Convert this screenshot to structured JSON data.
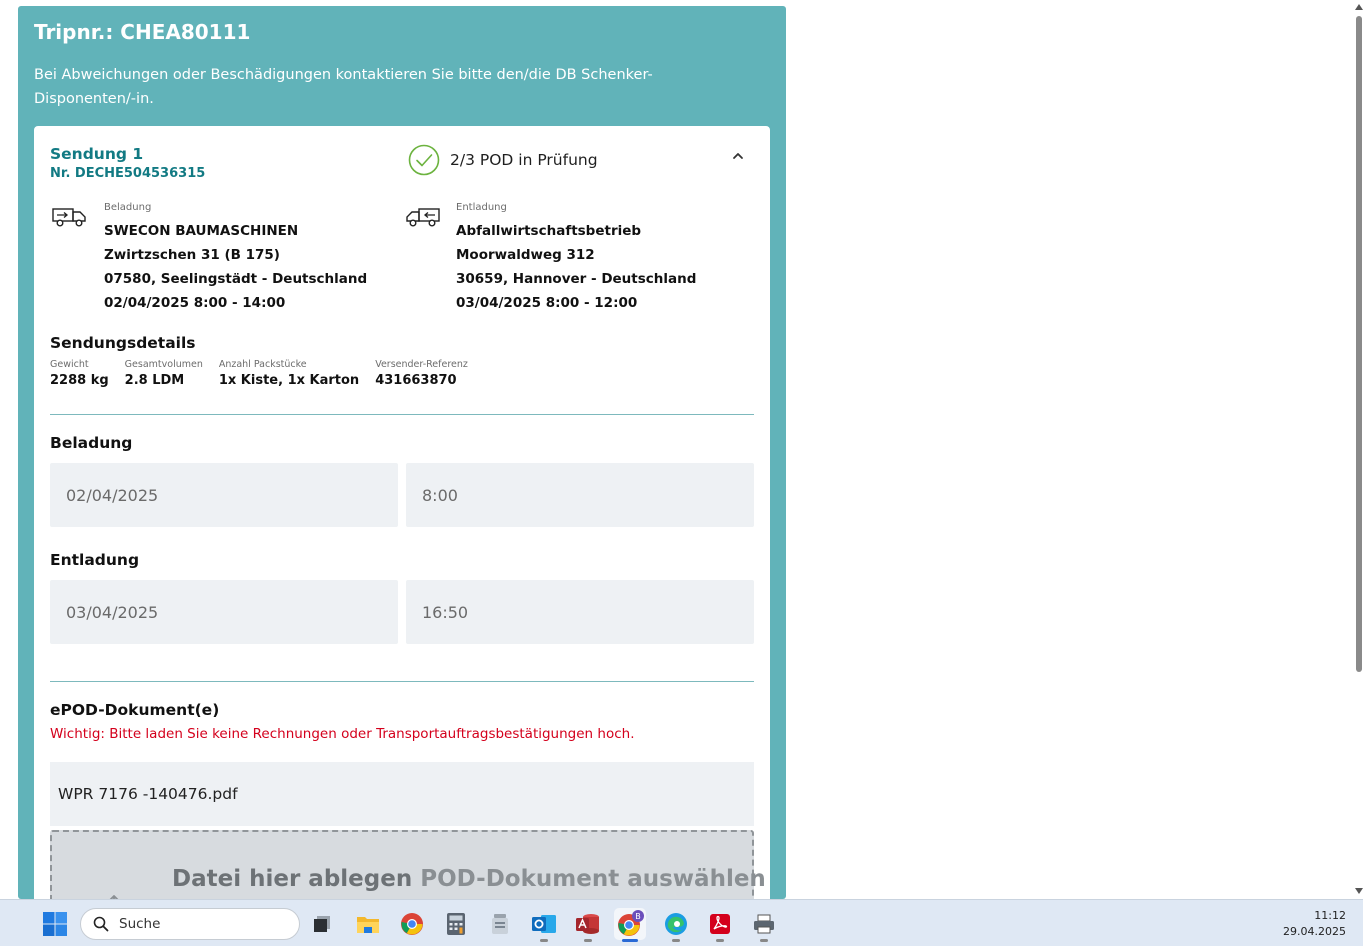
{
  "trip": {
    "title": "Tripnr.: CHEA80111",
    "notice": "Bei Abweichungen oder Beschädigungen kontaktieren Sie bitte den/die DB Schenker-Disponenten/-in."
  },
  "shipment": {
    "title": "Sendung 1",
    "number": "Nr. DECHE504536315",
    "status": "2/3  POD in Prüfung",
    "loading": {
      "label": "Beladung",
      "company": "SWECON BAUMASCHINEN",
      "street": "Zwirtzschen 31 (B 175)",
      "city": "07580, Seelingstädt - Deutschland",
      "time": "02/04/2025 8:00 - 14:00"
    },
    "unloading": {
      "label": "Entladung",
      "company": "Abfallwirtschaftsbetrieb",
      "street": "Moorwaldweg 312",
      "city": "30659, Hannover - Deutschland",
      "time": "03/04/2025 8:00 - 12:00"
    }
  },
  "details": {
    "title": "Sendungsdetails",
    "items": [
      {
        "label": "Gewicht",
        "value": "2288 kg"
      },
      {
        "label": "Gesamtvolumen",
        "value": "2.8 LDM"
      },
      {
        "label": "Anzahl Packstücke",
        "value": "1x Kiste, 1x Karton"
      },
      {
        "label": "Versender-Referenz",
        "value": "431663870"
      }
    ]
  },
  "beladung": {
    "title": "Beladung",
    "date": "02/04/2025",
    "time": "8:00"
  },
  "entladung": {
    "title": "Entladung",
    "date": "03/04/2025",
    "time": "16:50"
  },
  "epod": {
    "title": "ePOD-Dokument(e)",
    "warning": "Wichtig: Bitte laden Sie keine Rechnungen oder Transportauftragsbestätigungen hoch.",
    "file": "WPR 7176 -140476.pdf",
    "drop_text": "Datei hier ablegen",
    "select_text": "POD-Dokument auswählen"
  },
  "taskbar": {
    "search_placeholder": "Suche",
    "time": "11:12",
    "date": "29.04.2025",
    "chrome_badge": "B",
    "apps": [
      "task-view-icon",
      "file-explorer-icon",
      "chrome-icon",
      "calculator-icon",
      "app-icon",
      "outlook-icon",
      "access-icon",
      "chrome-profile-icon",
      "edge-icon",
      "acrobat-icon",
      "printer-icon"
    ]
  },
  "colors": {
    "accent": "#61b3b9",
    "title": "#127a83",
    "warning": "#d4001c",
    "status": "#6cb33f"
  }
}
